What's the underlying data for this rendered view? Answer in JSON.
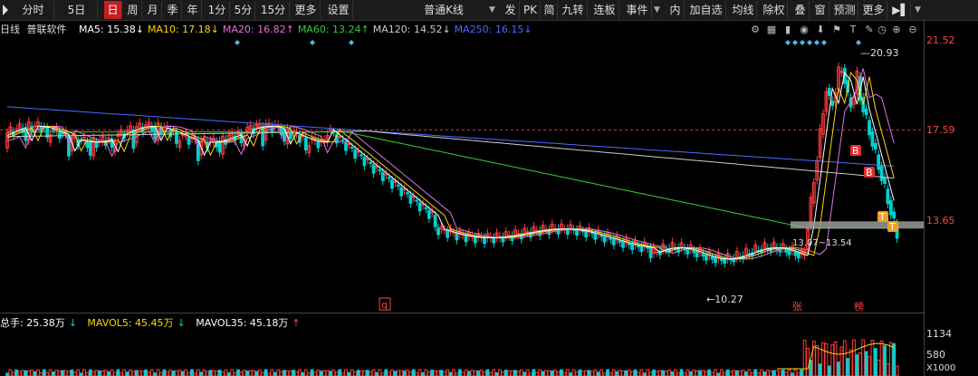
{
  "toolbar": {
    "items": [
      "分时",
      "5日",
      "日",
      "周",
      "月",
      "季",
      "年",
      "1分",
      "5分",
      "15分",
      "更多",
      "设置"
    ],
    "active": "日",
    "kline_type": "普通K线",
    "right_items": [
      "发",
      "PK",
      "简",
      "九转",
      "连板",
      "事件",
      "内",
      "加自选",
      "均线",
      "除权",
      "叠",
      "窗",
      "预测",
      "更多"
    ]
  },
  "indicators": {
    "period": "日线",
    "stock": "普联软件",
    "ma": [
      {
        "label": "MA5: 15.38",
        "arrow": "↓",
        "color": "#ffffff"
      },
      {
        "label": "MA10: 17.18",
        "arrow": "↓",
        "color": "#ffd700"
      },
      {
        "label": "MA20: 16.82",
        "arrow": "↑",
        "color": "#e070e0"
      },
      {
        "label": "MA60: 13.24",
        "arrow": "↑",
        "color": "#33cc33"
      },
      {
        "label": "MA120: 14.52",
        "arrow": "↓",
        "color": "#cccccc"
      },
      {
        "label": "MA250: 16.15",
        "arrow": "↓",
        "color": "#4a6cff"
      }
    ]
  },
  "price_axis": {
    "top": "21.52",
    "mid": "17.59",
    "low": "13.65"
  },
  "annotations": {
    "high": "20.93",
    "low": "10.27",
    "range": "13.07~13.54",
    "zhang": "张",
    "bang": "榜",
    "q": "q",
    "B": "B",
    "T": "T"
  },
  "volume": {
    "total": {
      "label": "总手: 25.38万",
      "arrow": "↓",
      "color": "#ffffff"
    },
    "mavol5": {
      "label": "MAVOL5: 45.45万",
      "arrow": "↓",
      "color": "#ffd700"
    },
    "mavol35": {
      "label": "MAVOL35: 45.18万",
      "arrow": "↑",
      "color": "#ffffff"
    },
    "axis_top": "1134",
    "axis_mid": "580",
    "unit": "X1000"
  },
  "colors": {
    "up": "#ff3b3b",
    "down": "#00d0d0",
    "accent": "#c41e1e"
  }
}
